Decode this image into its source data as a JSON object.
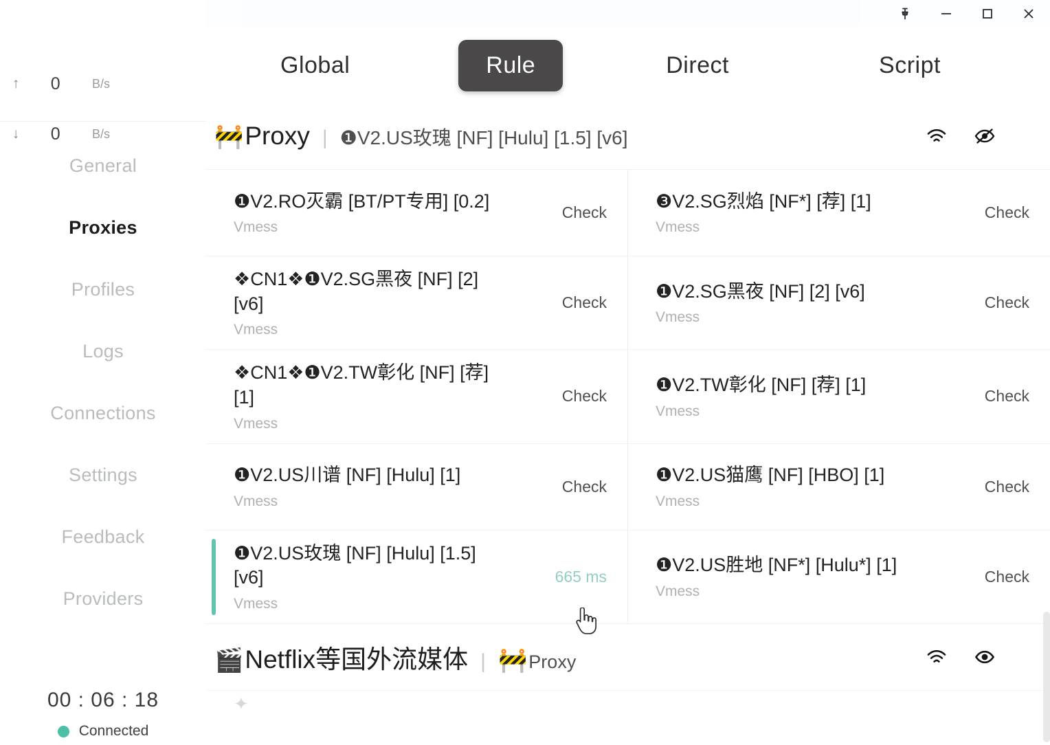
{
  "window": {
    "controls": [
      {
        "name": "pin",
        "label": "Pin"
      },
      {
        "name": "minimize",
        "label": "Minimize"
      },
      {
        "name": "maximize",
        "label": "Maximize"
      },
      {
        "name": "close",
        "label": "Close"
      }
    ]
  },
  "sidebar": {
    "speed": {
      "upload": {
        "arrow": "↑",
        "value": "0",
        "unit": "B/s"
      },
      "download": {
        "arrow": "↓",
        "value": "0",
        "unit": "B/s"
      }
    },
    "items": [
      {
        "label": "General",
        "active": false
      },
      {
        "label": "Proxies",
        "active": true
      },
      {
        "label": "Profiles",
        "active": false
      },
      {
        "label": "Logs",
        "active": false
      },
      {
        "label": "Connections",
        "active": false
      },
      {
        "label": "Settings",
        "active": false
      },
      {
        "label": "Feedback",
        "active": false
      },
      {
        "label": "Providers",
        "active": false
      }
    ],
    "status": {
      "timer": "00 : 06 : 18",
      "connection": "Connected",
      "dot_color": "#4cc0a5"
    }
  },
  "modes": {
    "tabs": [
      {
        "label": "Global",
        "active": false
      },
      {
        "label": "Rule",
        "active": true
      },
      {
        "label": "Direct",
        "active": false
      },
      {
        "label": "Script",
        "active": false
      }
    ],
    "active_color": "#4a4848"
  },
  "groups": [
    {
      "emoji": "🚧",
      "name": "Proxy",
      "separator": "|",
      "current": "❶V2.US玫瑰 [NF] [Hulu] [1.5] [v6]",
      "speedtest_icon": "wifi-icon",
      "visibility_icon": "eye-off-icon",
      "expanded": true,
      "proxies": [
        {
          "name": "❶V2.RO灭霸 [BT/PT专用] [0.2]",
          "type": "Vmess",
          "latency": "Check",
          "selected": false
        },
        {
          "name": "❸V2.SG烈焰 [NF*] [荐] [1]",
          "type": "Vmess",
          "latency": "Check",
          "selected": false
        },
        {
          "name": "❖CN1❖❶V2.SG黑夜 [NF] [2] [v6]",
          "type": "Vmess",
          "latency": "Check",
          "selected": false
        },
        {
          "name": "❶V2.SG黑夜 [NF] [2] [v6]",
          "type": "Vmess",
          "latency": "Check",
          "selected": false
        },
        {
          "name": "❖CN1❖❶V2.TW彰化 [NF] [荐] [1]",
          "type": "Vmess",
          "latency": "Check",
          "selected": false
        },
        {
          "name": "❶V2.TW彰化 [NF] [荐] [1]",
          "type": "Vmess",
          "latency": "Check",
          "selected": false
        },
        {
          "name": "❶V2.US川谱 [NF] [Hulu] [1]",
          "type": "Vmess",
          "latency": "Check",
          "selected": false
        },
        {
          "name": "❶V2.US猫鹰 [NF] [HBO] [1]",
          "type": "Vmess",
          "latency": "Check",
          "selected": false
        },
        {
          "name": "❶V2.US玫瑰 [NF] [Hulu] [1.5] [v6]",
          "type": "Vmess",
          "latency": "665 ms",
          "selected": true
        },
        {
          "name": "❶V2.US胜地 [NF*] [Hulu*] [1]",
          "type": "Vmess",
          "latency": "Check",
          "selected": false
        }
      ]
    },
    {
      "emoji": "🎬",
      "name": "Netflix等国外流媒体",
      "separator": "|",
      "current_emoji": "🚧",
      "current": "Proxy",
      "speedtest_icon": "wifi-icon",
      "visibility_icon": "eye-icon",
      "expanded": false,
      "proxies": []
    }
  ]
}
